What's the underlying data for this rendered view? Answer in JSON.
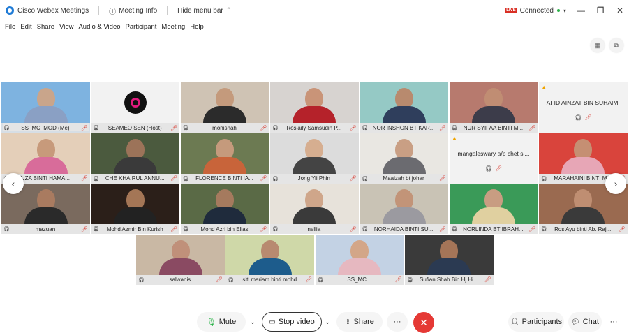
{
  "titlebar": {
    "app_title": "Cisco Webex Meetings",
    "meeting_info": "Meeting Info",
    "hide_menu": "Hide menu bar",
    "live_badge": "LIVE",
    "connection_status": "Connected"
  },
  "menu": [
    "File",
    "Edit",
    "Share",
    "View",
    "Audio & Video",
    "Participant",
    "Meeting",
    "Help"
  ],
  "tiles": [
    {
      "name": "SS_MC_MOD (Me)",
      "type": "video",
      "bg": "#7eb3e0",
      "skin": "#c9a58b",
      "clothes": "#8aa0c4",
      "active": true
    },
    {
      "name": "SEAMEO SEN (Host)",
      "type": "logo",
      "bg": "#f2f2f2"
    },
    {
      "name": "monishah",
      "type": "video",
      "bg": "#cfc3b4",
      "skin": "#c49a7c",
      "clothes": "#2b2b2b"
    },
    {
      "name": "Roslaily Samsudin P...",
      "type": "video",
      "bg": "#d7d3d0",
      "skin": "#c99478",
      "clothes": "#b5222a"
    },
    {
      "name": "NOR INSHON BT KAR...",
      "type": "video",
      "bg": "#95c9c5",
      "skin": "#b88a6e",
      "clothes": "#2f3e5c"
    },
    {
      "name": "NUR SYIFAA BINTI M...",
      "type": "video",
      "bg": "#b77a6e",
      "skin": "#c08d73",
      "clothes": "#3c3c4a"
    },
    {
      "name": "AFID AINZAT BIN SUHAIMI",
      "type": "nocam",
      "bg": "#f2f2f2"
    },
    {
      "name": "UZA BINTI HAMA...",
      "type": "video",
      "bg": "#e4cfb9",
      "skin": "#c79a7b",
      "clothes": "#d86c9a"
    },
    {
      "name": "CHE KHAIRUL ANNU...",
      "type": "video",
      "bg": "#4b5a3e",
      "skin": "#9c7359",
      "clothes": "#3a3a3a"
    },
    {
      "name": "FLORENCE BINTI IA...",
      "type": "video",
      "bg": "#6c7a52",
      "skin": "#c59a7c",
      "clothes": "#c8643a"
    },
    {
      "name": "Jong Yii Phin",
      "type": "video",
      "bg": "#dcdcdc",
      "skin": "#d6ae90",
      "clothes": "#444444"
    },
    {
      "name": "Maaizah bt johar",
      "type": "video",
      "bg": "#e9e7e2",
      "skin": "#c99f84",
      "clothes": "#6b6b70"
    },
    {
      "name": "mangaleswary a/p chet si...",
      "type": "nocam",
      "bg": "#f2f2f2"
    },
    {
      "name": "MARAHAINI BINTI M...",
      "type": "video",
      "bg": "#d9443c",
      "skin": "#c58f73",
      "clothes": "#e7a6b6"
    },
    {
      "name": "mazuan",
      "type": "video",
      "bg": "#7a6a5e",
      "skin": "#a97b60",
      "clothes": "#2a2a2a"
    },
    {
      "name": "Mohd Azmir Bin Kurish",
      "type": "video",
      "bg": "#2b1f19",
      "skin": "#a47656",
      "clothes": "#222222"
    },
    {
      "name": "Mohd Azri bin Elias",
      "type": "video",
      "bg": "#5a6a46",
      "skin": "#a57a5e",
      "clothes": "#1f2b3c"
    },
    {
      "name": "nellia",
      "type": "video",
      "bg": "#e7e2da",
      "skin": "#cfa68a",
      "clothes": "#3a3a3a"
    },
    {
      "name": "NORHAIDA BINTI SU...",
      "type": "video",
      "bg": "#c9c3b5",
      "skin": "#c29478",
      "clothes": "#9b9aa0"
    },
    {
      "name": "NORLINDA BT IBRAH...",
      "type": "video",
      "bg": "#3a9a58",
      "skin": "#c89d82",
      "clothes": "#e0d0a0"
    },
    {
      "name": "Ros Ayu binti Ab. Raj...",
      "type": "video",
      "bg": "#9a6a50",
      "skin": "#bf8e72",
      "clothes": "#3a3a3a"
    },
    {
      "name": "salwanis",
      "type": "video",
      "bg": "#c9b8a4",
      "skin": "#c0907a",
      "clothes": "#8a4a62"
    },
    {
      "name": "siti mariam binti mohd",
      "type": "video",
      "bg": "#cfd8a8",
      "skin": "#b88a70",
      "clothes": "#1d5c8c"
    },
    {
      "name": "SS_MC...",
      "type": "video",
      "bg": "#c3d2e4",
      "skin": "#d3a688",
      "clothes": "#e6b8c0"
    },
    {
      "name": "Sufian Shah Bin Hj Hi...",
      "type": "video",
      "bg": "#3a3a3a",
      "skin": "#a57558",
      "clothes": "#2b3a52"
    }
  ],
  "controls": {
    "mute": "Mute",
    "stop_video": "Stop video",
    "share": "Share",
    "participants": "Participants",
    "chat": "Chat"
  }
}
